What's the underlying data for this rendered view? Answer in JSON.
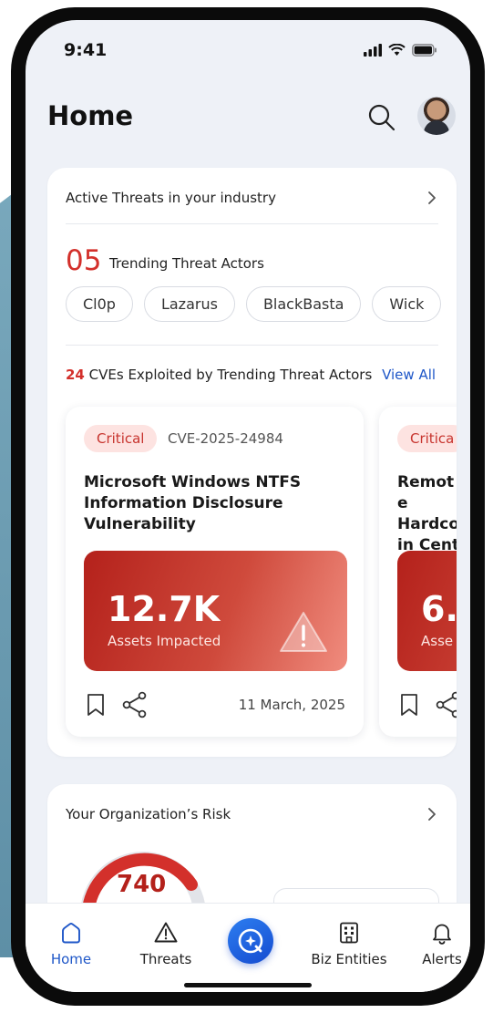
{
  "status_bar": {
    "time": "9:41"
  },
  "header": {
    "title": "Home"
  },
  "threats_card": {
    "title": "Active Threats in your industry",
    "trending_count": "05",
    "trending_label": "Trending Threat Actors",
    "actors": [
      "Cl0p",
      "Lazarus",
      "BlackBasta",
      "Wick"
    ],
    "cve_count": "24",
    "cve_label": "CVEs Exploited by Trending Threat Actors",
    "view_all": "View All",
    "cves": [
      {
        "severity": "Critical",
        "id": "CVE-2025-24984",
        "title": "Microsoft Windows NTFS Information Disclosure Vulnerability",
        "impact_value": "12.7K",
        "impact_label": "Assets Impacted",
        "date": "11 March, 2025"
      },
      {
        "severity": "Critica",
        "title": "Remote Hardco in Cent",
        "impact_value": "6.",
        "impact_label": "Asse"
      }
    ]
  },
  "risk_card": {
    "title": "Your Organization’s Risk",
    "score": "740"
  },
  "bottom_nav": {
    "items": [
      {
        "label": "Home",
        "icon": "home-icon",
        "active": true
      },
      {
        "label": "Threats",
        "icon": "warning-icon",
        "active": false
      },
      {
        "label": "Biz Entities",
        "icon": "building-icon",
        "active": false
      },
      {
        "label": "Alerts",
        "icon": "bell-icon",
        "active": false
      }
    ]
  },
  "colors": {
    "accent": "#1f57c8",
    "critical": "#d3302b",
    "screen_bg": "#eef1f7"
  }
}
